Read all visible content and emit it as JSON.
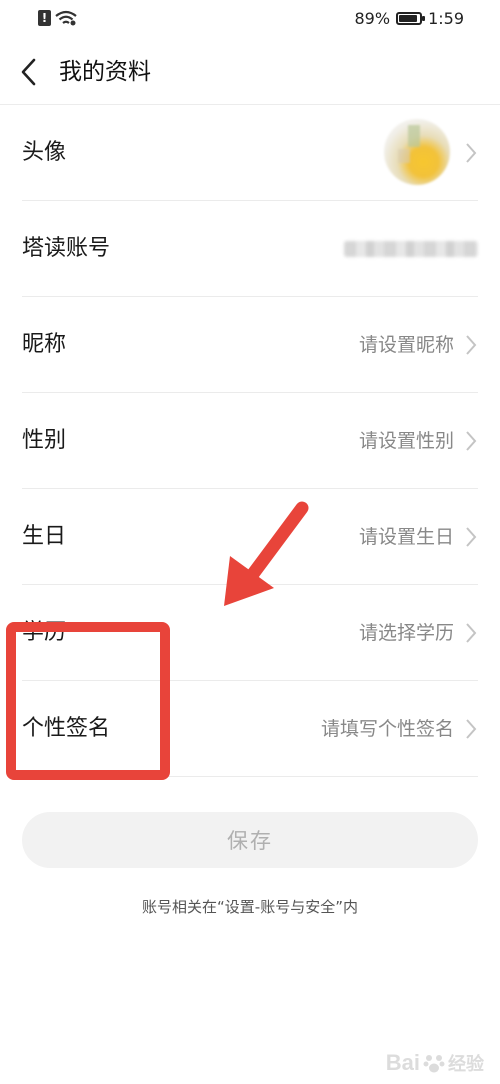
{
  "status_bar": {
    "alert_glyph": "!",
    "battery_percent": "89%",
    "battery_level": 0.89,
    "time": "1:59",
    "icons": [
      "alert-icon",
      "wifi-icon",
      "battery-icon"
    ]
  },
  "header": {
    "back_icon": "back-chevron-icon",
    "title": "我的资料"
  },
  "rows": [
    {
      "label": "头像",
      "value": "",
      "type": "avatar"
    },
    {
      "label": "塔读账号",
      "value": "",
      "type": "account"
    },
    {
      "label": "昵称",
      "value": "请设置昵称"
    },
    {
      "label": "性别",
      "value": "请设置性别"
    },
    {
      "label": "生日",
      "value": "请设置生日"
    },
    {
      "label": "学历",
      "value": "请选择学历"
    },
    {
      "label": "个性签名",
      "value": "请填写个性签名"
    }
  ],
  "save_label": "保存",
  "footer_note": "账号相关在“设置-账号与安全”内",
  "annotation": {
    "color": "#e8443a"
  },
  "watermark": {
    "text": "Bai",
    "sub": "经验"
  }
}
